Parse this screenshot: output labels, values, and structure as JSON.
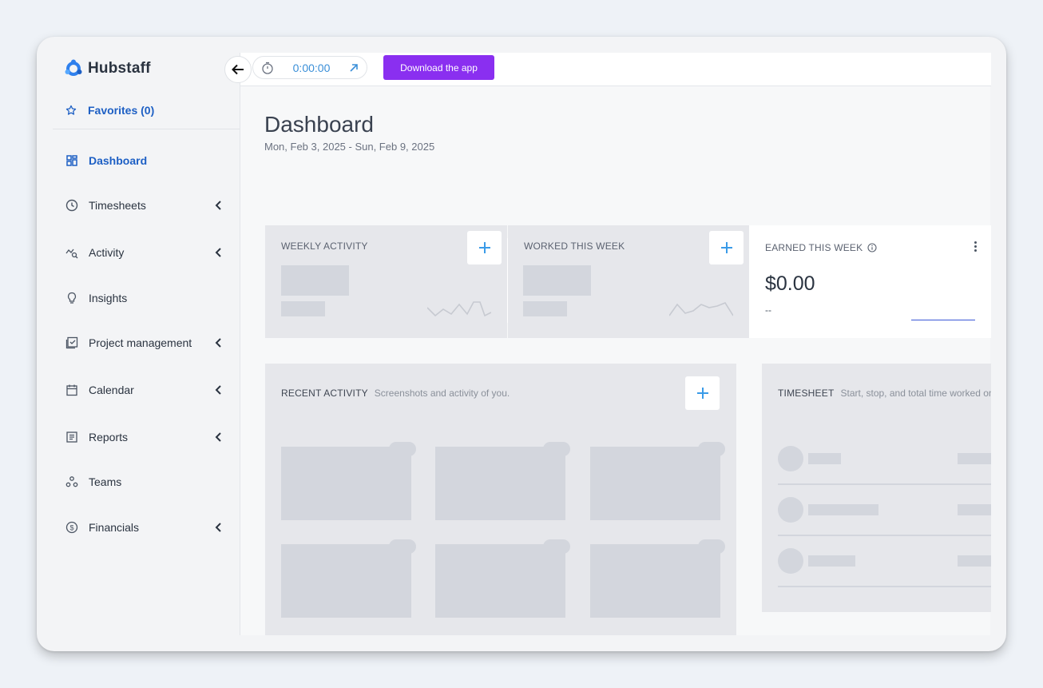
{
  "brand": {
    "name": "Hubstaff"
  },
  "sidebar": {
    "favorites_label": "Favorites (0)",
    "items": [
      {
        "label": "Dashboard",
        "icon": "dashboard-icon",
        "active": true,
        "expandable": false
      },
      {
        "label": "Timesheets",
        "icon": "clock-icon",
        "expandable": true
      },
      {
        "label": "Activity",
        "icon": "activity-icon",
        "expandable": true
      },
      {
        "label": "Insights",
        "icon": "lightbulb-icon",
        "expandable": false
      },
      {
        "label": "Project management",
        "icon": "checklist-icon",
        "expandable": true
      },
      {
        "label": "Calendar",
        "icon": "calendar-icon",
        "expandable": true
      },
      {
        "label": "Reports",
        "icon": "report-icon",
        "expandable": true
      },
      {
        "label": "Teams",
        "icon": "teams-icon",
        "expandable": false
      },
      {
        "label": "Financials",
        "icon": "dollar-icon",
        "expandable": true
      }
    ]
  },
  "topbar": {
    "timer_value": "0:00:00",
    "download_label": "Download the app"
  },
  "page": {
    "title": "Dashboard",
    "date_range": "Mon, Feb 3, 2025 - Sun, Feb 9, 2025"
  },
  "widgets": {
    "weekly_activity": {
      "label": "WEEKLY ACTIVITY"
    },
    "worked_this_week": {
      "label": "WORKED THIS WEEK"
    },
    "earned_this_week": {
      "label": "EARNED THIS WEEK",
      "value": "$0.00",
      "sub": "--"
    },
    "recent_activity": {
      "label": "RECENT ACTIVITY",
      "desc": "Screenshots and activity of you."
    },
    "timesheet": {
      "label": "TIMESHEET",
      "desc": "Start, stop, and total time worked on"
    }
  },
  "colors": {
    "accent": "#1d5fc4",
    "download": "#8a2ff0",
    "timer": "#3a8fd8"
  }
}
